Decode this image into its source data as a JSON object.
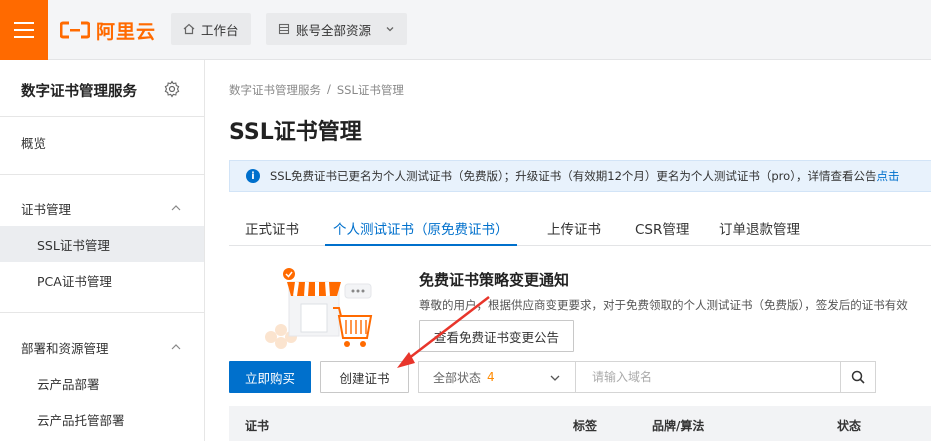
{
  "topbar": {
    "brand": "阿里云",
    "workbench_label": "工作台",
    "resources_label": "账号全部资源"
  },
  "sidebar": {
    "title": "数字证书管理服务",
    "overview": "概览",
    "groups": [
      {
        "label": "证书管理",
        "items": [
          "SSL证书管理",
          "PCA证书管理"
        ]
      },
      {
        "label": "部署和资源管理",
        "items": [
          "云产品部署",
          "云产品托管部署"
        ]
      }
    ]
  },
  "breadcrumb": [
    "数字证书管理服务",
    "/",
    "SSL证书管理"
  ],
  "page": {
    "title": "SSL证书管理"
  },
  "notice": {
    "text": "SSL免费证书已更名为个人测试证书（免费版）；升级证书（有效期12个月）更名为个人测试证书（pro），详情查看公告",
    "link": "点击"
  },
  "tabs": [
    "正式证书",
    "个人测试证书（原免费证书）",
    "上传证书",
    "CSR管理",
    "订单退款管理"
  ],
  "active_tab": "个人测试证书（原免费证书）",
  "promo": {
    "title": "免费证书策略变更通知",
    "text": "尊敬的用户，根据供应商变更要求，对于免费领取的个人测试证书（免费版），签发后的证书有效",
    "button": "查看免费证书变更公告"
  },
  "toolbar": {
    "buy_label": "立即购买",
    "create_label": "创建证书",
    "status_select": "全部状态",
    "status_count": "4",
    "search_placeholder": "请输入域名"
  },
  "table": {
    "columns": [
      "证书",
      "标签",
      "品牌/算法",
      "状态"
    ]
  },
  "colors": {
    "brand": "#ff6a00",
    "primary": "#0070cc",
    "annotation": "#e8352b"
  }
}
